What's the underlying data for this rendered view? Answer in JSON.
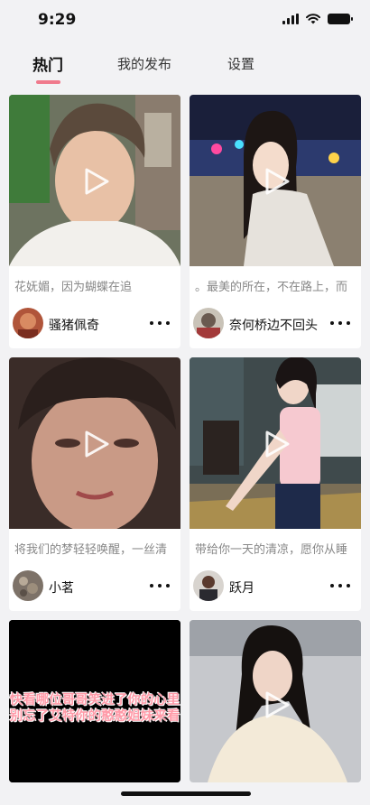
{
  "status": {
    "time": "9:29"
  },
  "tabs": [
    {
      "label": "热门",
      "active": true
    },
    {
      "label": "我的发布",
      "active": false
    },
    {
      "label": "设置",
      "active": false
    }
  ],
  "cards": [
    {
      "caption": "花妩媚，因为蝴蝶在追",
      "author": "骚猪佩奇"
    },
    {
      "caption": "。最美的所在，不在路上，而",
      "author": "奈何桥边不回头"
    },
    {
      "caption": "将我们的梦轻轻唤醒，一丝清",
      "author": "小茗"
    },
    {
      "caption": "带给你一天的清凉，愿你从睡",
      "author": "跃月"
    },
    {
      "overlay_line1": "快看哪位哥哥笑进了你的心里",
      "overlay_line2": "别忘了艾特你的憨憨姐妹来看"
    },
    {}
  ],
  "colors": {
    "accent": "#f07a8c",
    "background": "#f2f2f4"
  }
}
